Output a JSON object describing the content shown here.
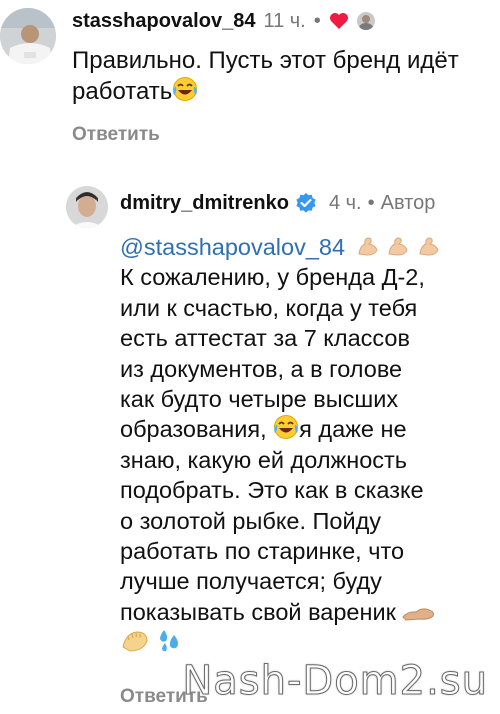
{
  "comment1": {
    "username": "stasshapovalov_84",
    "time": "11 ч.",
    "dot": "•",
    "text": "Правильно. Пусть этот бренд идёт работать",
    "emoji": "laughing-tears-emoji",
    "reply": "Ответить",
    "heart_color": "#ed1c40"
  },
  "comment2": {
    "username": "dmitry_dmitrenko",
    "time": "4 ч.",
    "dot": "•",
    "author_badge": "Автор",
    "mention": "@stasshapovalov_84",
    "lines": [
      "К сожалению, у бренда Д-2,",
      "или к счастью, когда у тебя",
      "есть аттестат за 7 классов",
      "из документов, а в голове",
      "как будто четыре высших",
      "образования,",
      "я даже не",
      "знаю, какую ей должность",
      "подобрать. Это как в сказке",
      "о золотой рыбке. Пойду",
      "работать по старинке, что",
      "лучше получается; буду",
      "показывать свой вареник"
    ],
    "reply": "Ответить",
    "verified_color": "#3897f0"
  },
  "watermark": "Nash-Dom2.su"
}
